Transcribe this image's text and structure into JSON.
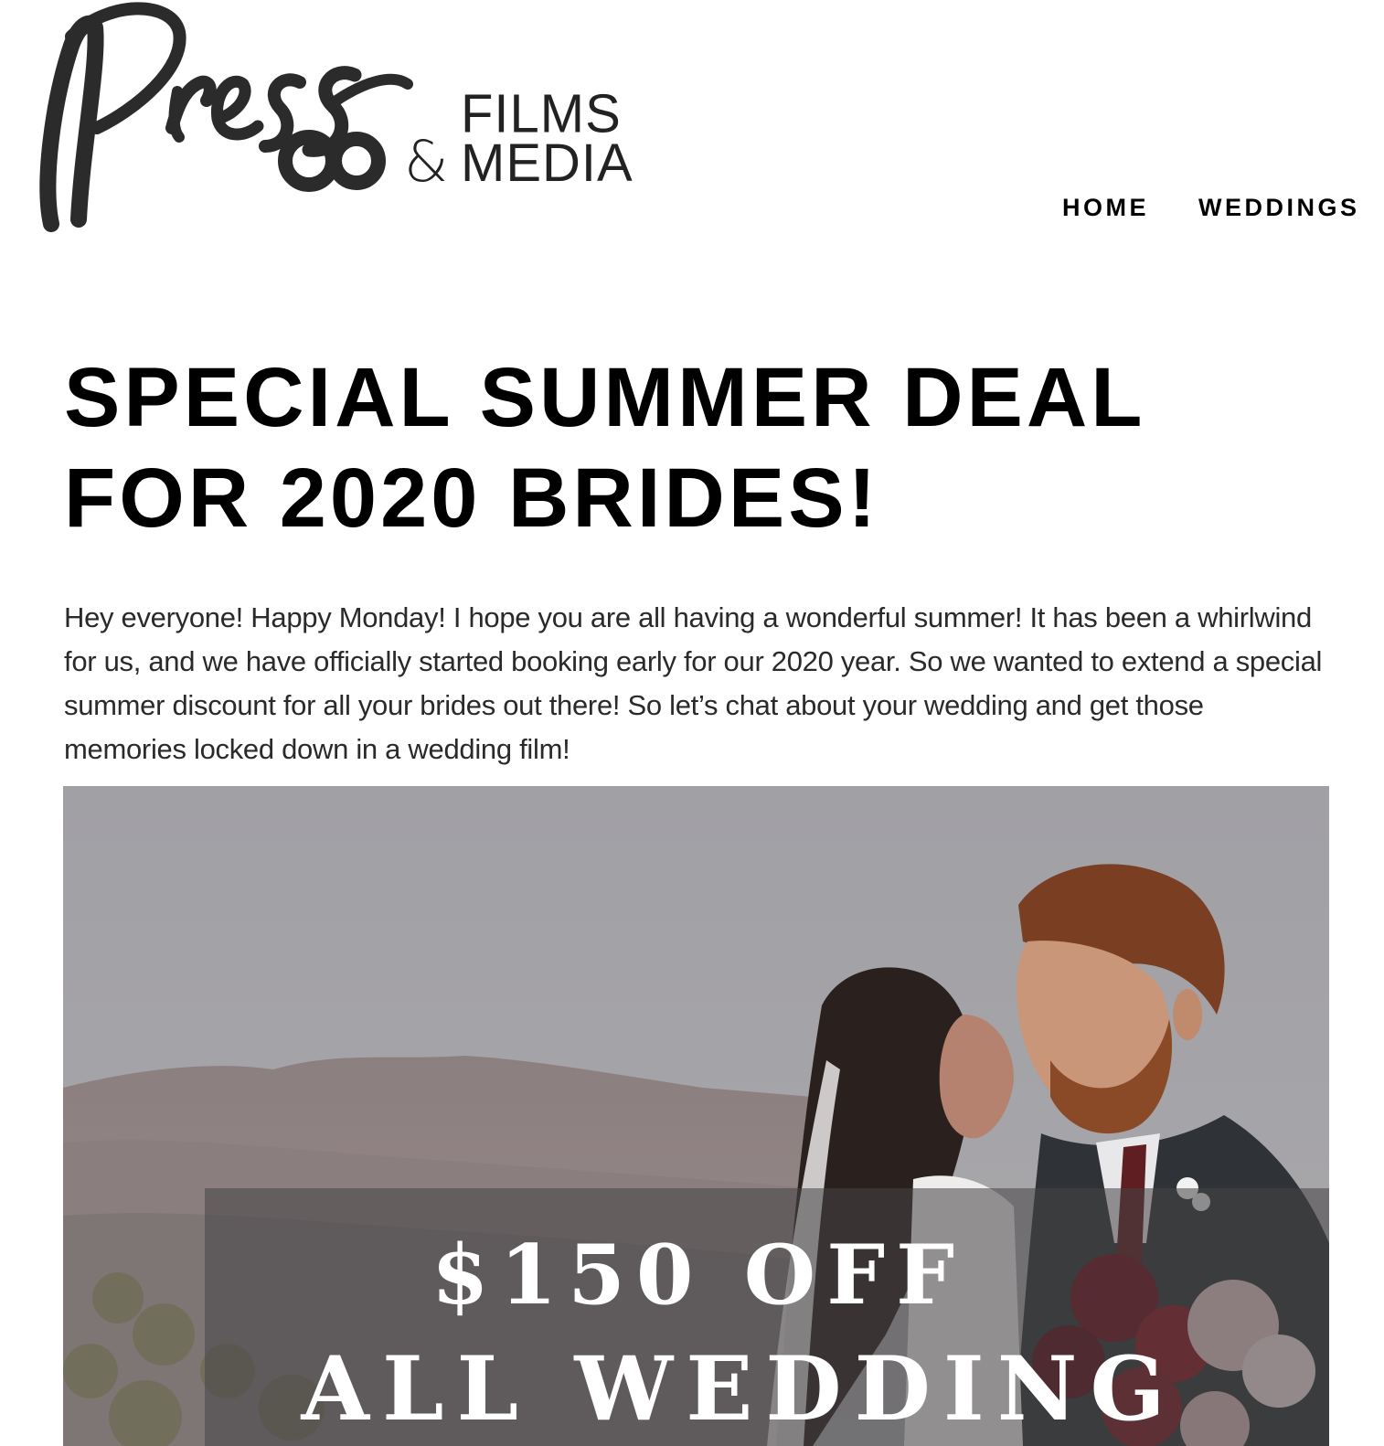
{
  "brand": {
    "script_word": "Press",
    "line1": "FILMS",
    "ampersand": "&",
    "line2": "MEDIA"
  },
  "nav": {
    "items": [
      {
        "label": "HOME"
      },
      {
        "label": "WEDDINGS"
      }
    ]
  },
  "post": {
    "title": "SPECIAL SUMMER DEAL FOR 2020 BRIDES!",
    "body": "Hey everyone! Happy Monday! I hope you are all having a wonderful summer! It has been a whirlwind for us, and we have officially started booking early for our 2020 year. So we wanted to extend a special summer discount for all your brides out there! So let’s chat about your wedding and get those memories locked down in a wedding film!"
  },
  "hero": {
    "line1": "$150 OFF",
    "line2": "ALL WEDDING"
  }
}
